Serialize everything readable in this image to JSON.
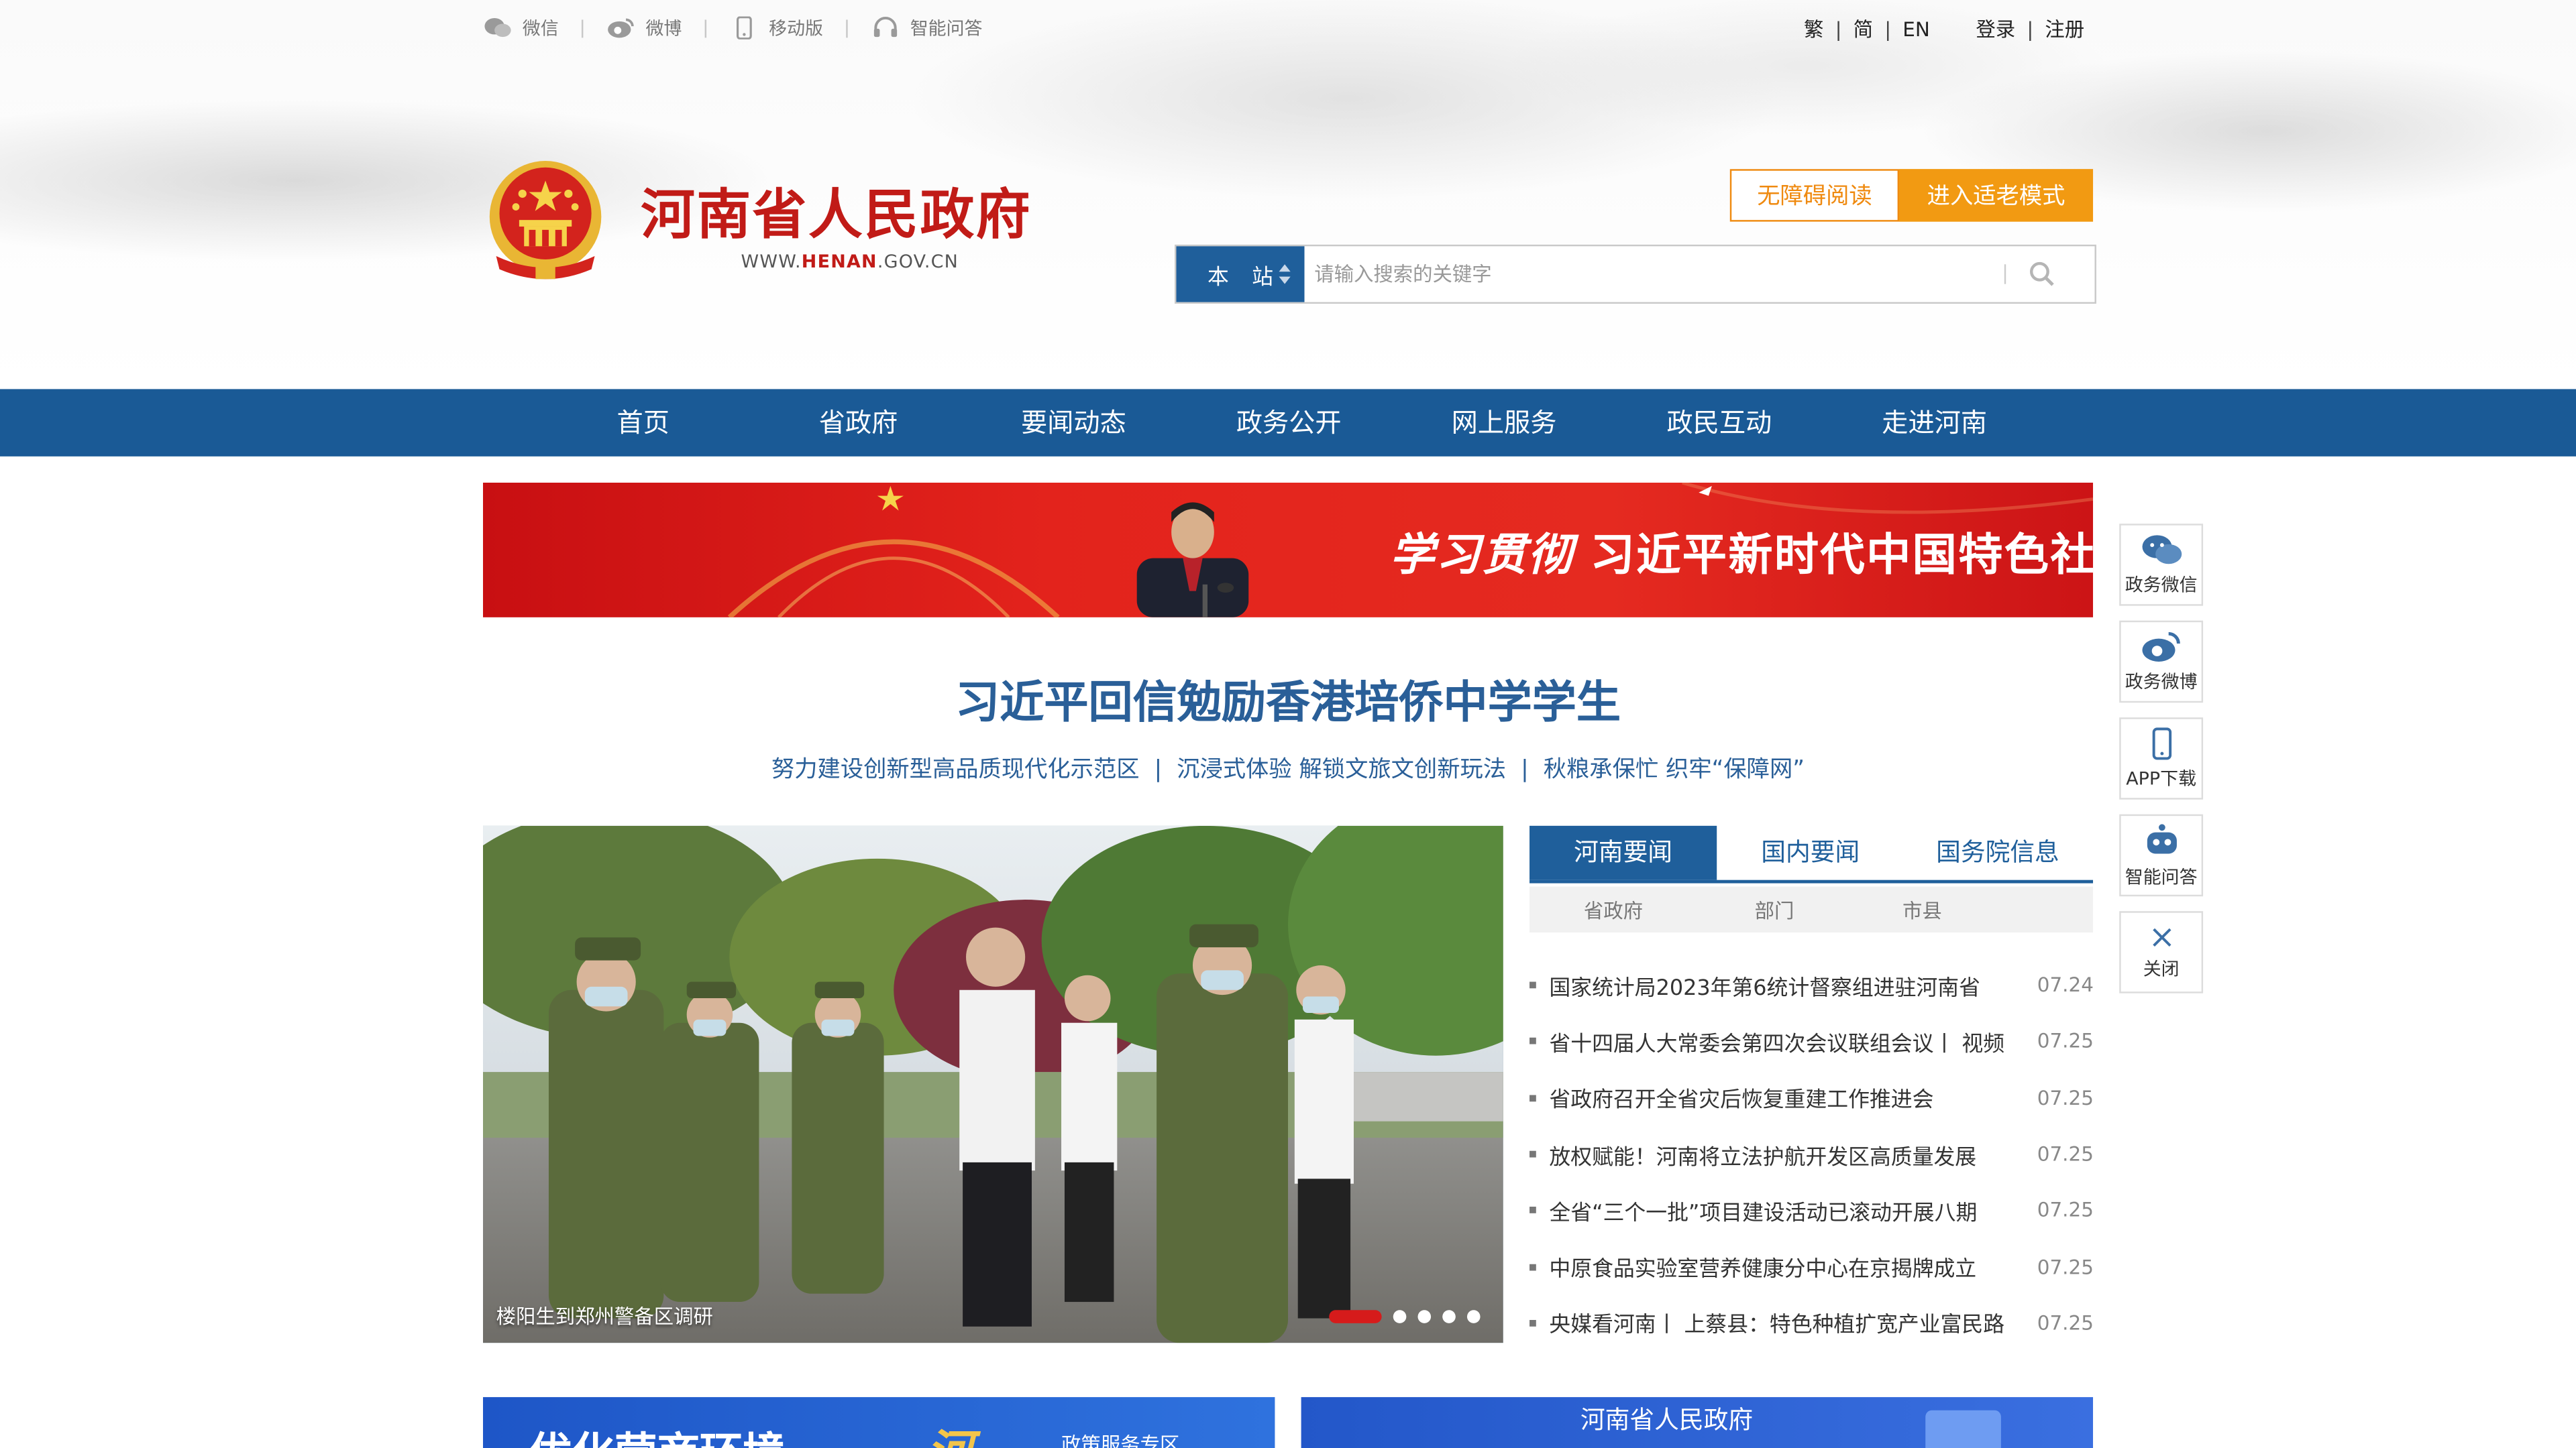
{
  "topbar": {
    "wechat": "微信",
    "weibo": "微博",
    "mobile": "移动版",
    "qa": "智能问答",
    "trad": "繁",
    "simp": "简",
    "en": "EN",
    "login": "登录",
    "register": "注册",
    "sep": "|"
  },
  "brand": {
    "title": "河南省人民政府",
    "url_prefix": "WWW.",
    "url_mid": "HENAN",
    "url_suffix": ".GOV.CN",
    "primary_red": "#c11b17"
  },
  "accessibility": {
    "barrier_free": "无障碍阅读",
    "elder_mode": "进入适老模式"
  },
  "search": {
    "scope_a": "本",
    "scope_b": "站",
    "placeholder": "请输入搜索的关键字"
  },
  "nav": {
    "color": "#1a5a96",
    "items": [
      "首页",
      "省政府",
      "要闻动态",
      "政务公开",
      "网上服务",
      "政民互动",
      "走进河南"
    ]
  },
  "banner": {
    "calligraphy": "学习贯彻",
    "text": "习近平新时代中国特色社会主义思想"
  },
  "headline": {
    "main": "习近平回信勉励香港培侨中学学生",
    "subs": [
      "努力建设创新型高品质现代化示范区",
      "沉浸式体验 解锁文旅文创新玩法",
      "秋粮承保忙 织牢“保障网”"
    ],
    "sep": "|"
  },
  "photo": {
    "caption": "楼阳生到郑州警备区调研",
    "slides": 5,
    "active_slide": 1
  },
  "news": {
    "tabs": [
      "河南要闻",
      "国内要闻",
      "国务院信息"
    ],
    "subtabs": [
      "省政府",
      "部门",
      "市县"
    ],
    "items": [
      {
        "title": "国家统计局2023年第6统计督察组进驻河南省",
        "date": "07.24"
      },
      {
        "title": "省十四届人大常委会第四次会议联组会议丨 视频",
        "date": "07.25"
      },
      {
        "title": "省政府召开全省灾后恢复重建工作推进会",
        "date": "07.25"
      },
      {
        "title": "放权赋能！河南将立法护航开发区高质量发展",
        "date": "07.25"
      },
      {
        "title": "全省“三个一批”项目建设活动已滚动开展八期",
        "date": "07.25"
      },
      {
        "title": "中原食品实验室营养健康分中心在京揭牌成立",
        "date": "07.25"
      },
      {
        "title": "央媒看河南丨 上蔡县：特色种植扩宽产业富民路",
        "date": "07.25"
      }
    ]
  },
  "float": {
    "items": [
      "政务微信",
      "政务微博",
      "APP下载",
      "智能问答",
      "关闭"
    ]
  },
  "promos": {
    "left_title": "优化营商环境",
    "left_accent": "河",
    "left_sub": "政策服务专区",
    "right_title": "河南省人民政府"
  }
}
